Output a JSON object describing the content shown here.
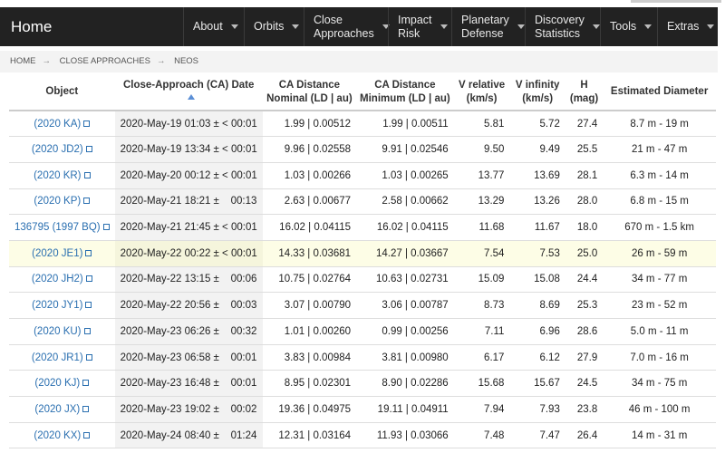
{
  "navbar": {
    "brand": "Home",
    "items": [
      {
        "label": "About"
      },
      {
        "label": "Orbits"
      },
      {
        "label": "Close\nApproaches"
      },
      {
        "label": "Impact\nRisk"
      },
      {
        "label": "Planetary\nDefense"
      },
      {
        "label": "Discovery\nStatistics"
      },
      {
        "label": "Tools"
      },
      {
        "label": "Extras"
      }
    ]
  },
  "breadcrumb": [
    "HOME",
    "CLOSE APPROACHES",
    "NEOS"
  ],
  "table": {
    "headers": {
      "object": "Object",
      "date": "Close-Approach (CA) Date",
      "nominal": "CA Distance\nNominal (LD | au)",
      "minimum": "CA Distance\nMinimum (LD | au)",
      "vrel": "V relative\n(km/s)",
      "vinf": "V infinity\n(km/s)",
      "h": "H\n(mag)",
      "diam": "Estimated Diameter"
    },
    "rows": [
      {
        "object": "(2020 KA)",
        "date": "2020-May-19 01:03 ± < 00:01",
        "nominal": "1.99 | 0.00512",
        "minimum": "1.99 | 0.00511",
        "vrel": "5.81",
        "vinf": "5.72",
        "h": "27.4",
        "diam": "8.7 m - 19 m"
      },
      {
        "object": "(2020 JD2)",
        "date": "2020-May-19 13:34 ± < 00:01",
        "nominal": "9.96 | 0.02558",
        "minimum": "9.91 | 0.02546",
        "vrel": "9.50",
        "vinf": "9.49",
        "h": "25.5",
        "diam": "21 m - 47 m"
      },
      {
        "object": "(2020 KR)",
        "date": "2020-May-20 00:12 ± < 00:01",
        "nominal": "1.03 | 0.00266",
        "minimum": "1.03 | 0.00265",
        "vrel": "13.77",
        "vinf": "13.69",
        "h": "28.1",
        "diam": "6.3 m - 14 m"
      },
      {
        "object": "(2020 KP)",
        "date": "2020-May-21 18:21 ±    00:13",
        "nominal": "2.63 | 0.00677",
        "minimum": "2.58 | 0.00662",
        "vrel": "13.29",
        "vinf": "13.26",
        "h": "28.0",
        "diam": "6.8 m - 15 m"
      },
      {
        "object": "136795 (1997 BQ)",
        "date": "2020-May-21 21:45 ± < 00:01",
        "nominal": "16.02 | 0.04115",
        "minimum": "16.02 | 0.04115",
        "vrel": "11.68",
        "vinf": "11.67",
        "h": "18.0",
        "diam": "670 m - 1.5 km"
      },
      {
        "object": "(2020 JE1)",
        "date": "2020-May-22 00:22 ± < 00:01",
        "nominal": "14.33 | 0.03681",
        "minimum": "14.27 | 0.03667",
        "vrel": "7.54",
        "vinf": "7.53",
        "h": "25.0",
        "diam": "26 m - 59 m",
        "highlight": true
      },
      {
        "object": "(2020 JH2)",
        "date": "2020-May-22 13:15 ±    00:06",
        "nominal": "10.75 | 0.02764",
        "minimum": "10.63 | 0.02731",
        "vrel": "15.09",
        "vinf": "15.08",
        "h": "24.4",
        "diam": "34 m - 77 m"
      },
      {
        "object": "(2020 JY1)",
        "date": "2020-May-22 20:56 ±    00:03",
        "nominal": "3.07 | 0.00790",
        "minimum": "3.06 | 0.00787",
        "vrel": "8.73",
        "vinf": "8.69",
        "h": "25.3",
        "diam": "23 m - 52 m"
      },
      {
        "object": "(2020 KU)",
        "date": "2020-May-23 06:26 ±    00:32",
        "nominal": "1.01 | 0.00260",
        "minimum": "0.99 | 0.00256",
        "vrel": "7.11",
        "vinf": "6.96",
        "h": "28.6",
        "diam": "5.0 m - 11 m"
      },
      {
        "object": "(2020 JR1)",
        "date": "2020-May-23 06:58 ±    00:01",
        "nominal": "3.83 | 0.00984",
        "minimum": "3.81 | 0.00980",
        "vrel": "6.17",
        "vinf": "6.12",
        "h": "27.9",
        "diam": "7.0 m - 16 m"
      },
      {
        "object": "(2020 KJ)",
        "date": "2020-May-23 16:48 ±    00:01",
        "nominal": "8.95 | 0.02301",
        "minimum": "8.90 | 0.02286",
        "vrel": "15.68",
        "vinf": "15.67",
        "h": "24.5",
        "diam": "34 m - 75 m"
      },
      {
        "object": "(2020 JX)",
        "date": "2020-May-23 19:02 ±    00:02",
        "nominal": "19.36 | 0.04975",
        "minimum": "19.11 | 0.04911",
        "vrel": "7.94",
        "vinf": "7.93",
        "h": "23.8",
        "diam": "46 m - 100 m"
      },
      {
        "object": "(2020 KX)",
        "date": "2020-May-24 08:40 ±    01:24",
        "nominal": "12.31 | 0.03164",
        "minimum": "11.93 | 0.03066",
        "vrel": "7.48",
        "vinf": "7.47",
        "h": "26.4",
        "diam": "14 m - 31 m"
      }
    ]
  }
}
